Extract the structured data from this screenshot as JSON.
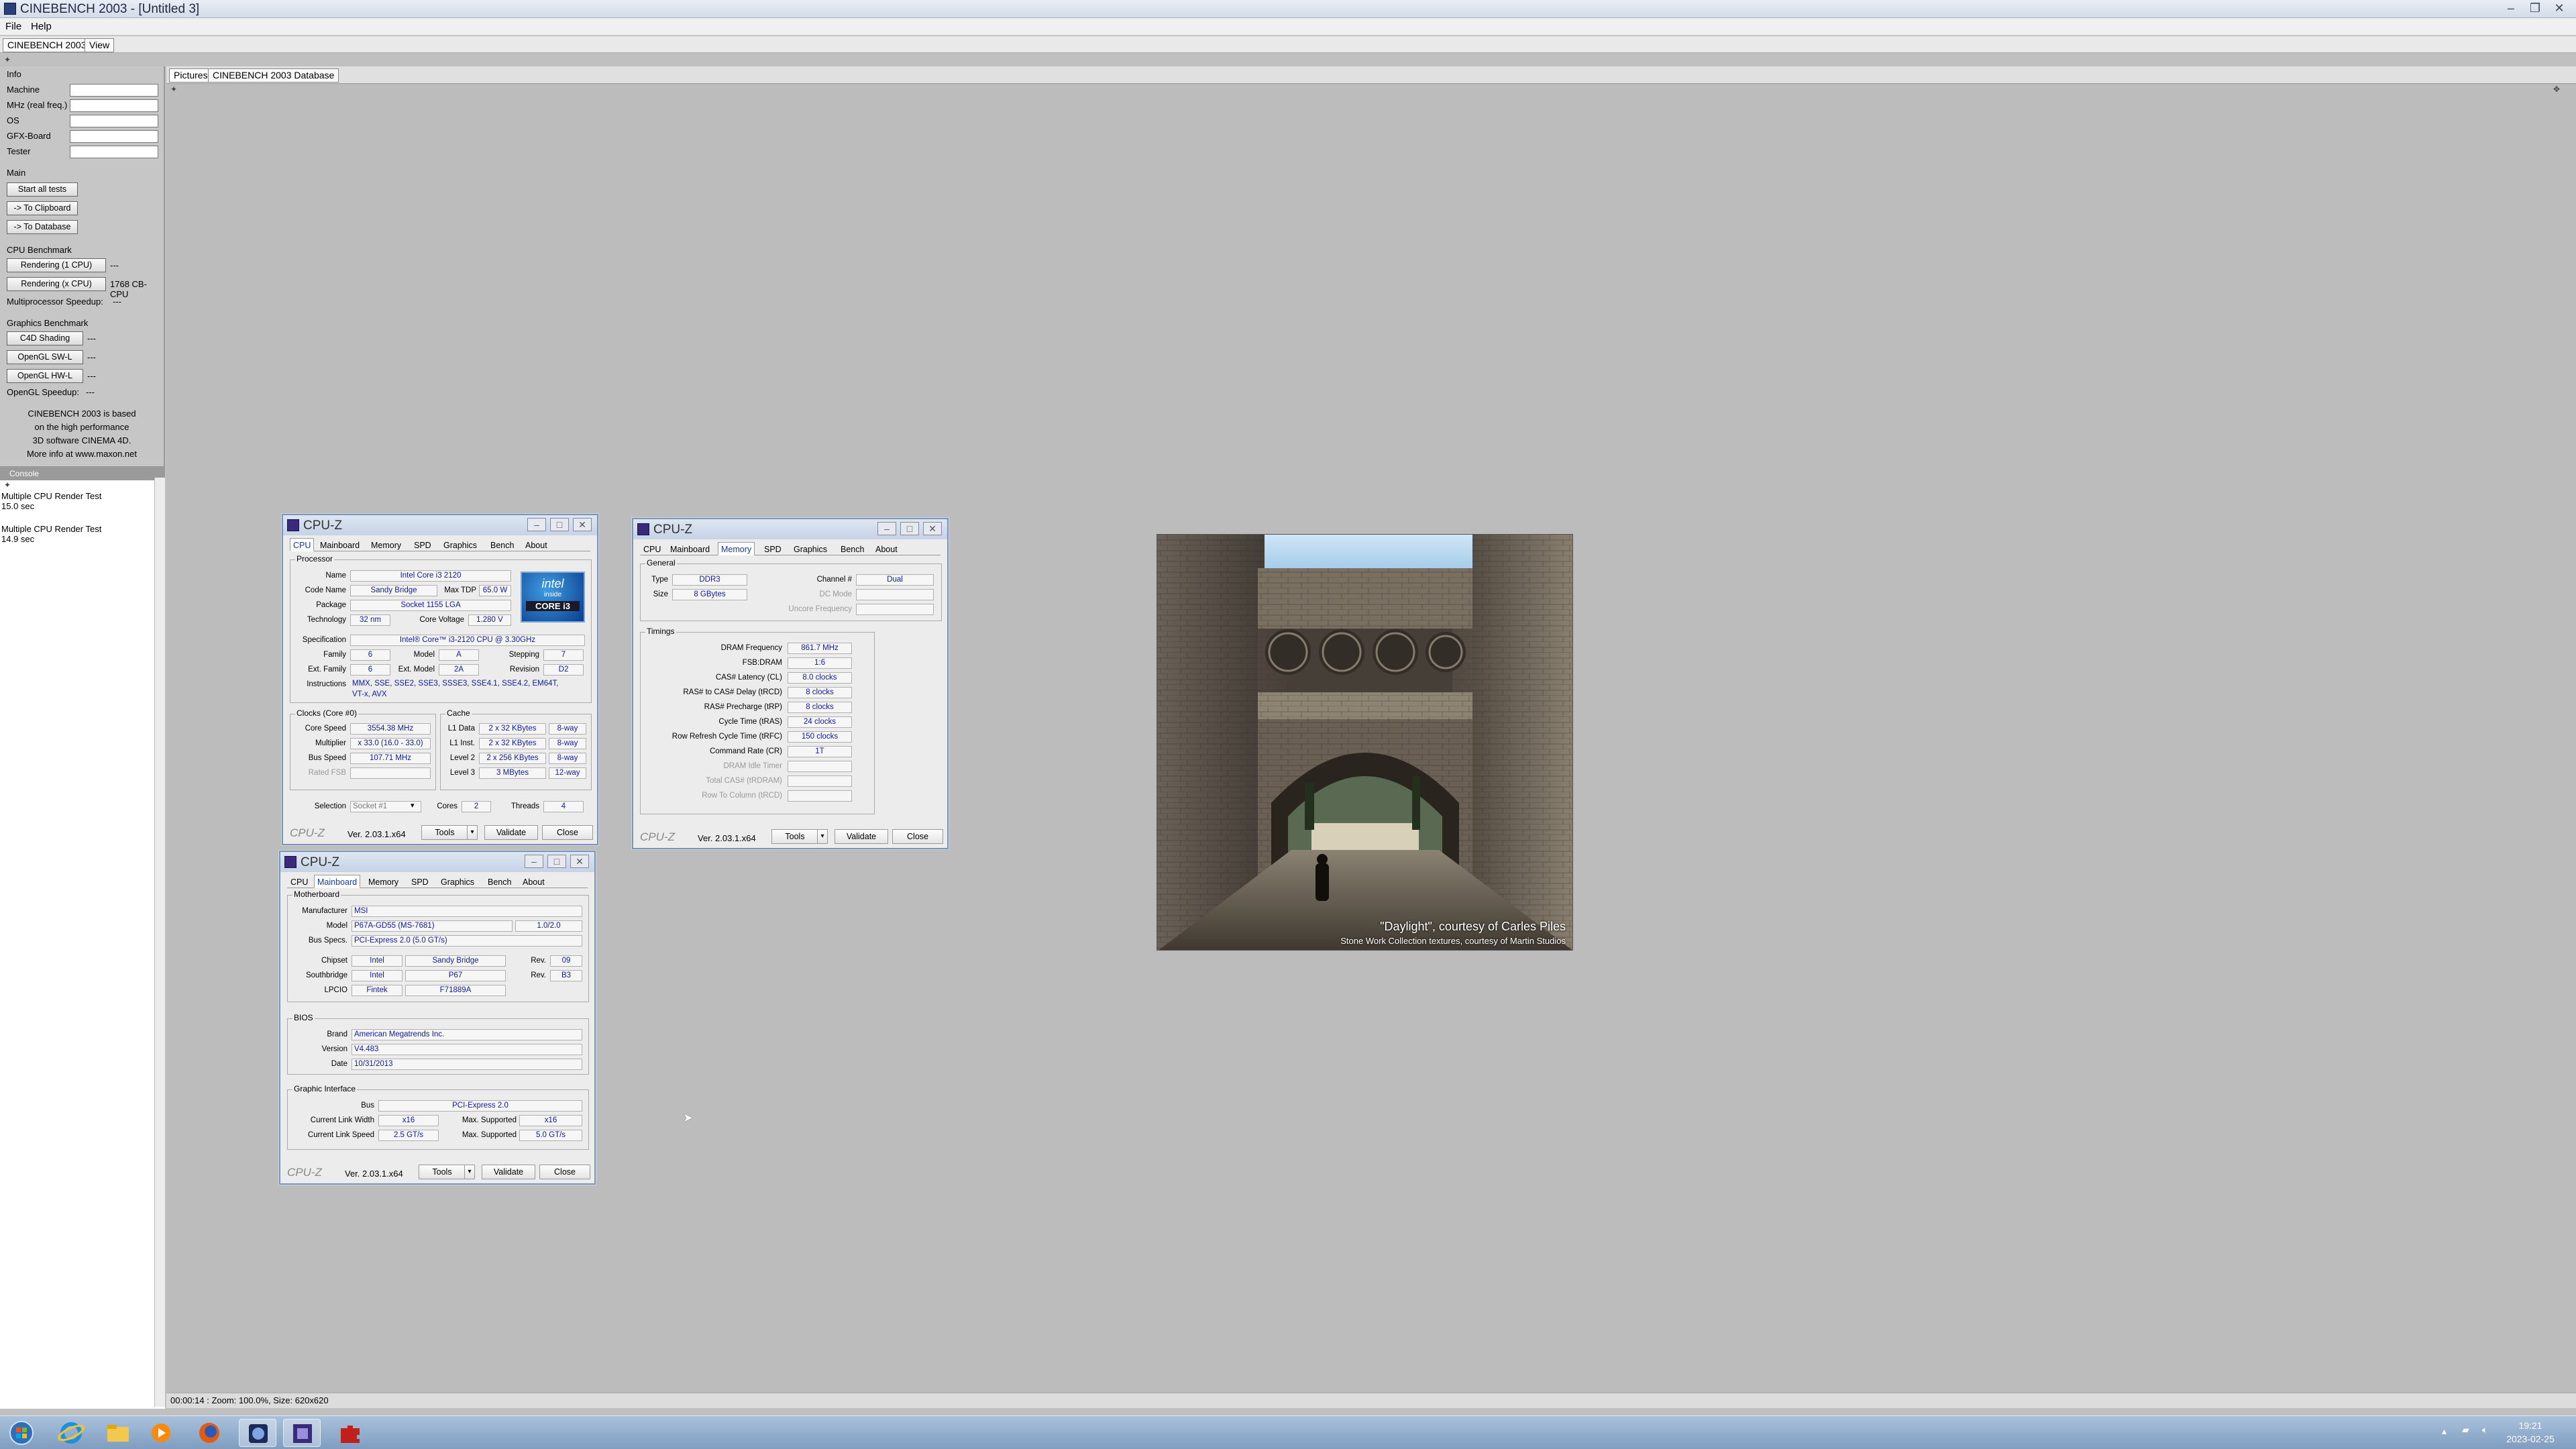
{
  "app": {
    "title": "CINEBENCH 2003 - [Untitled 3]",
    "menu": [
      "File",
      "Help"
    ],
    "tabs": [
      "CINEBENCH 2003",
      "View"
    ]
  },
  "left": {
    "info_header": "Info",
    "info_fields": [
      "Machine",
      "MHz (real freq.)",
      "OS",
      "GFX-Board",
      "Tester"
    ],
    "main_header": "Main",
    "main_buttons": [
      "Start all tests",
      "-> To Clipboard",
      "-> To Database"
    ],
    "cpu_header": "CPU Benchmark",
    "render_1cpu": "Rendering (1 CPU)",
    "render_1cpu_value": "---",
    "render_xcpu": "Rendering (x CPU)",
    "render_xcpu_value": "1768 CB-CPU",
    "mp_speedup": "Multiprocessor Speedup:",
    "mp_speedup_value": "---",
    "gfx_header": "Graphics Benchmark",
    "gfx_buttons": [
      "C4D Shading",
      "OpenGL SW-L",
      "OpenGL HW-L"
    ],
    "gfx_values": [
      "---",
      "---",
      "---"
    ],
    "ogl_speedup": "OpenGL Speedup:",
    "ogl_speedup_value": "---",
    "note": [
      "CINEBENCH 2003 is based",
      "on the high performance",
      "3D software CINEMA 4D.",
      "More info at www.maxon.net"
    ],
    "console_header": "Console",
    "console": [
      {
        "line1": "Multiple CPU Render Test",
        "line2": "15.0 sec"
      },
      {
        "line1": "Multiple CPU Render Test",
        "line2": "14.9 sec"
      }
    ]
  },
  "workspace": {
    "tabs": [
      "Pictures",
      "CINEBENCH 2003 Database"
    ],
    "caption1": "\"Daylight\", courtesy of Carles Piles",
    "caption2": "Stone Work Collection textures, courtesy of Martin Studios",
    "status": "00:00:14 : Zoom: 100.0%, Size: 620x620"
  },
  "cpuz": {
    "title": "CPU-Z",
    "tabs": [
      "CPU",
      "Mainboard",
      "Memory",
      "SPD",
      "Graphics",
      "Bench",
      "About"
    ],
    "version": "Ver. 2.03.1.x64",
    "tools": "Tools",
    "validate": "Validate",
    "close": "Close",
    "logo": "CPU-Z"
  },
  "cpu": {
    "processor": "Processor",
    "name_l": "Name",
    "name": "Intel Core i3 2120",
    "code_l": "Code Name",
    "code": "Sandy Bridge",
    "tdp_l": "Max TDP",
    "tdp": "65.0 W",
    "pkg_l": "Package",
    "pkg": "Socket 1155 LGA",
    "tech_l": "Technology",
    "tech": "32 nm",
    "volt_l": "Core Voltage",
    "volt": "1.280 V",
    "spec_l": "Specification",
    "spec": "Intel® Core™ i3-2120 CPU @ 3.30GHz",
    "fam_l": "Family",
    "fam": "6",
    "model_l": "Model",
    "model": "A",
    "step_l": "Stepping",
    "step": "7",
    "efam_l": "Ext. Family",
    "efam": "6",
    "emodel_l": "Ext. Model",
    "emodel": "2A",
    "rev_l": "Revision",
    "rev": "D2",
    "instr_l": "Instructions",
    "instr1": "MMX, SSE, SSE2, SSE3, SSSE3, SSE4.1, SSE4.2, EM64T,",
    "instr2": "VT-x, AVX",
    "clocks": "Clocks (Core #0)",
    "cs_l": "Core Speed",
    "cs": "3554.38 MHz",
    "mult_l": "Multiplier",
    "mult": "x 33.0 (16.0 - 33.0)",
    "bus_l": "Bus Speed",
    "bus": "107.71 MHz",
    "fsb_l": "Rated FSB",
    "cache": "Cache",
    "l1d_l": "L1 Data",
    "l1d": "2 x 32 KBytes",
    "l1d_w": "8-way",
    "l1i_l": "L1 Inst.",
    "l1i": "2 x 32 KBytes",
    "l1i_w": "8-way",
    "l2_l": "Level 2",
    "l2": "2 x 256 KBytes",
    "l2_w": "8-way",
    "l3_l": "Level 3",
    "l3": "3 MBytes",
    "l3_w": "12-way",
    "sel_l": "Selection",
    "sel": "Socket #1",
    "cores_l": "Cores",
    "cores": "2",
    "threads_l": "Threads",
    "threads": "4",
    "intel_top": "intel",
    "intel_mid": "inside",
    "intel_bot": "CORE i3"
  },
  "mem": {
    "general": "General",
    "type_l": "Type",
    "type": "DDR3",
    "size_l": "Size",
    "size": "8 GBytes",
    "chan_l": "Channel #",
    "chan": "Dual",
    "dc_l": "DC Mode",
    "unc_l": "Uncore Frequency",
    "timings": "Timings",
    "rows": [
      {
        "l": "DRAM Frequency",
        "v": "861.7 MHz"
      },
      {
        "l": "FSB:DRAM",
        "v": "1:6"
      },
      {
        "l": "CAS# Latency (CL)",
        "v": "8.0 clocks"
      },
      {
        "l": "RAS# to CAS# Delay (tRCD)",
        "v": "8 clocks"
      },
      {
        "l": "RAS# Precharge (tRP)",
        "v": "8 clocks"
      },
      {
        "l": "Cycle Time (tRAS)",
        "v": "24 clocks"
      },
      {
        "l": "Row Refresh Cycle Time (tRFC)",
        "v": "150 clocks"
      },
      {
        "l": "Command Rate (CR)",
        "v": "1T"
      },
      {
        "l": "DRAM Idle Timer",
        "v": ""
      },
      {
        "l": "Total CAS# (tRDRAM)",
        "v": ""
      },
      {
        "l": "Row To Column (tRCD)",
        "v": ""
      }
    ]
  },
  "mb": {
    "motherboard": "Motherboard",
    "man_l": "Manufacturer",
    "man": "MSI",
    "model_l": "Model",
    "model": "P67A-GD55 (MS-7681)",
    "model_rev": "1.0/2.0",
    "bus_l": "Bus Specs.",
    "bus": "PCI-Express 2.0 (5.0 GT/s)",
    "chip_l": "Chipset",
    "chip1": "Intel",
    "chip2": "Sandy Bridge",
    "chip_rev_l": "Rev.",
    "chip_rev": "09",
    "sb_l": "Southbridge",
    "sb1": "Intel",
    "sb2": "P67",
    "sb_rev_l": "Rev.",
    "sb_rev": "B3",
    "lpc_l": "LPCIO",
    "lpc1": "Fintek",
    "lpc2": "F71889A",
    "bios": "BIOS",
    "brand_l": "Brand",
    "brand": "American Megatrends Inc.",
    "ver_l": "Version",
    "ver": "V4.483",
    "date_l": "Date",
    "date": "10/31/2013",
    "gi": "Graphic Interface",
    "gbus_l": "Bus",
    "gbus": "PCI-Express 2.0",
    "clw_l": "Current Link Width",
    "clw": "x16",
    "msw_l": "Max. Supported",
    "msw": "x16",
    "cls_l": "Current Link Speed",
    "cls": "2.5 GT/s",
    "mss_l": "Max. Supported",
    "mss": "5.0 GT/s"
  },
  "taskbar": {
    "time": "19:21",
    "date": "2023-02-25"
  },
  "colors": {
    "value_text": "#0e1aa0",
    "window_border": "#7c94b8",
    "taskbar": "#8fabcc"
  }
}
